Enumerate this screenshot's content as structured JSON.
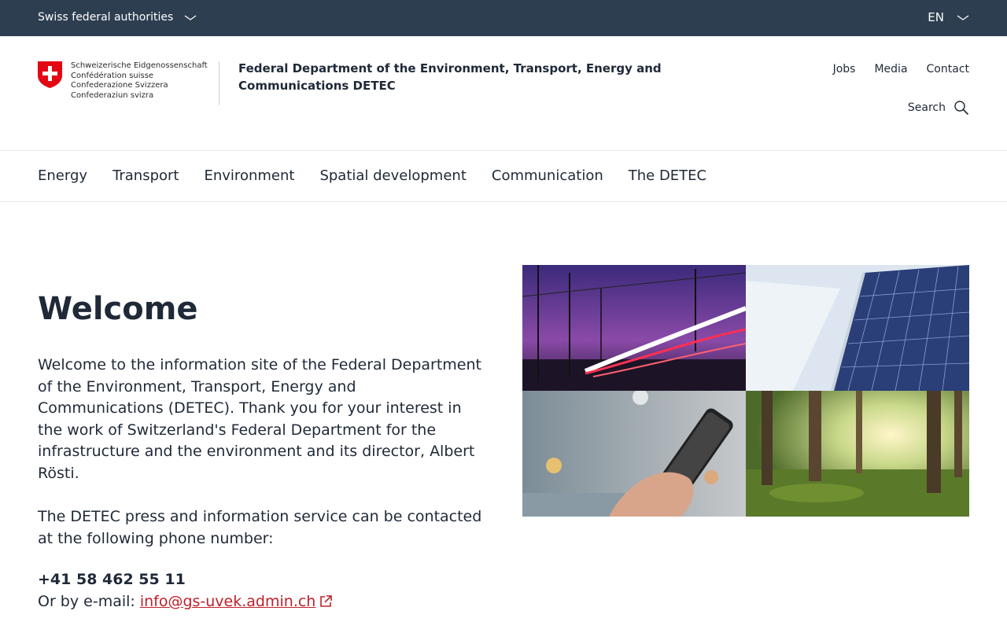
{
  "topbar": {
    "authorities_label": "Swiss federal authorities",
    "language": "EN"
  },
  "logo": {
    "lines": [
      "Schweizerische Eidgenossenschaft",
      "Confédération suisse",
      "Confederazione Svizzera",
      "Confederaziun svizra"
    ]
  },
  "header": {
    "department": "Federal Department of the Environment, Transport, Energy and Communications DETEC",
    "meta_nav": [
      "Jobs",
      "Media",
      "Contact"
    ],
    "search_label": "Search"
  },
  "main_nav": [
    "Energy",
    "Transport",
    "Environment",
    "Spatial development",
    "Communication",
    "The DETEC"
  ],
  "content": {
    "title": "Welcome",
    "intro": "Welcome to the information site of the Federal Department of the Environment, Transport, Energy and Communications (DETEC). Thank you for your interest in the work of Switzerland's Federal Department for the infrastructure and the environment and its director, Albert Rösti.",
    "press": "The DETEC press and information service can be contacted at the following phone number:",
    "phone": "+41 58 462 55 11",
    "email_prefix": "Or by e-mail:",
    "email": "info@gs-uvek.admin.ch"
  },
  "colors": {
    "topbar": "#2d3e50",
    "link_red": "#c0202a",
    "swiss_red": "#e30613"
  },
  "images": [
    "train-light-trails-image",
    "solar-panels-snow-image",
    "smartphone-hand-image",
    "forest-sunlight-image"
  ]
}
